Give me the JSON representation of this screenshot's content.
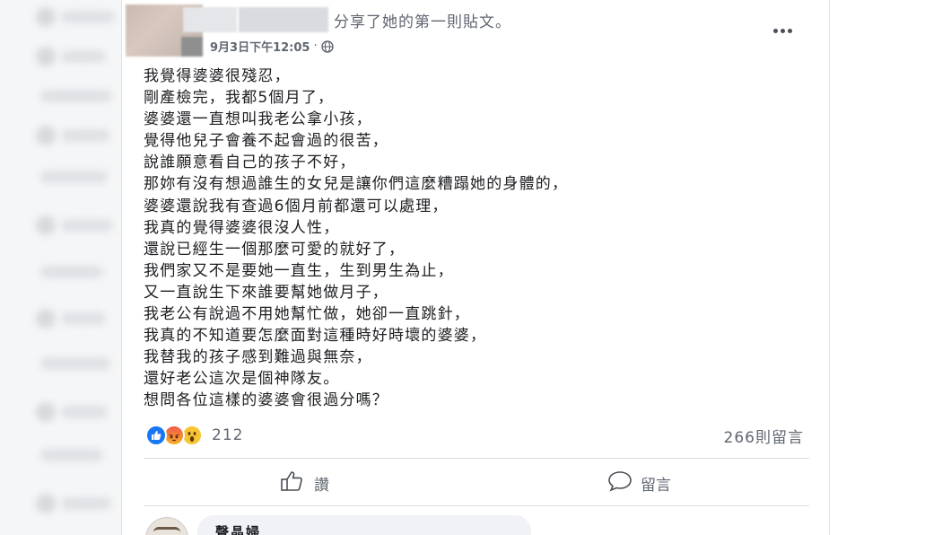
{
  "post": {
    "shared_text": "分享了她的第一則貼文。",
    "date": "9月3日下午12:05",
    "separator": "·",
    "privacy_icon": "globe-icon",
    "more_icon": "more-icon",
    "lines": [
      "我覺得婆婆很殘忍，",
      "剛產檢完，我都5個月了，",
      "婆婆還一直想叫我老公拿小孩，",
      "覺得他兒子會養不起會過的很苦，",
      "說誰願意看自己的孩子不好，",
      "那妳有沒有想過誰生的女兒是讓你們這麼糟蹋她的身體的，",
      "婆婆還說我有查過6個月前都還可以處理，",
      "我真的覺得婆婆很沒人性，",
      "還說已經生一個那麼可愛的就好了，",
      "我們家又不是要她一直生，生到男生為止，",
      "又一直說生下來誰要幫她做月子，",
      "我老公有說過不用她幫忙做，她卻一直跳針，",
      "我真的不知道要怎麼面對這種時好時壞的婆婆，",
      "我替我的孩子感到難過與無奈，",
      "還好老公這次是個神隊友。",
      "想問各位這樣的婆婆會很過分嗎？"
    ]
  },
  "reactions": {
    "icons": [
      "like-icon",
      "angry-icon",
      "wow-icon"
    ],
    "count": "212",
    "comments": "266則留言"
  },
  "actions": {
    "like_label": "讚",
    "comment_label": "留言"
  },
  "comment": {
    "author": "聲晶婦"
  },
  "colors": {
    "like_blue": "#1877f2",
    "secondary_text": "#606770",
    "divider": "#dadde1",
    "bubble": "#f0f2f5"
  }
}
